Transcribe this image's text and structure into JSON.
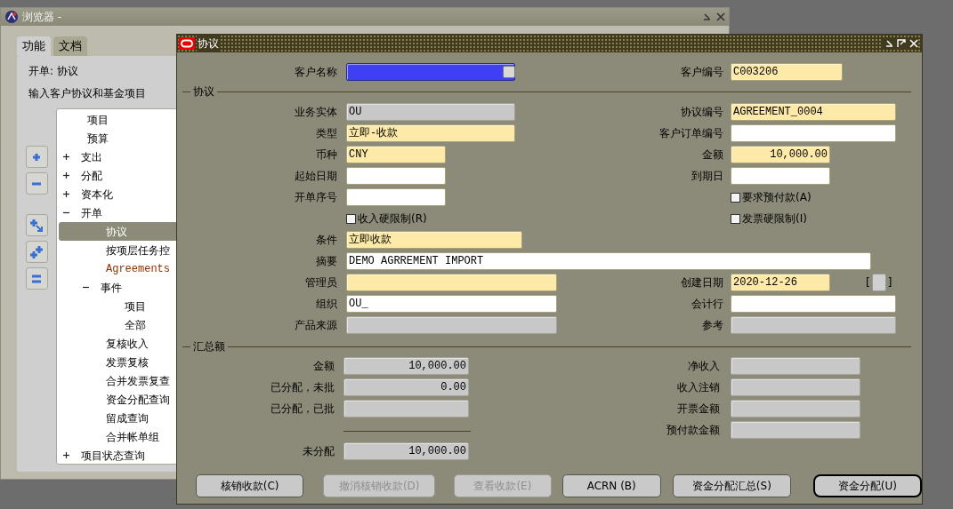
{
  "navigator": {
    "title": "浏览器 -",
    "tabs": [
      {
        "label": "功能",
        "selected": true
      },
      {
        "label": "文档",
        "selected": false
      }
    ],
    "path": "开单: 协议",
    "description": "输入客户协议和基金项目",
    "tree": [
      {
        "label": "项目",
        "kind": "node"
      },
      {
        "label": "预算",
        "kind": "node"
      },
      {
        "label": "支出",
        "kind": "node",
        "expanded": false
      },
      {
        "label": "分配",
        "kind": "node",
        "expanded": false
      },
      {
        "label": "资本化",
        "kind": "node",
        "expanded": false
      },
      {
        "label": "开单",
        "kind": "node",
        "expanded": true,
        "children": [
          {
            "label": "协议",
            "kind": "node",
            "selected": true
          },
          {
            "label": "按项层任务控",
            "kind": "node",
            "selected": false
          },
          {
            "label": "Agreements",
            "kind": "link",
            "selected": false
          },
          {
            "label": "事件",
            "kind": "node",
            "expanded": true,
            "children": [
              {
                "label": "项目",
                "kind": "node",
                "selected": false
              },
              {
                "label": "全部",
                "kind": "node",
                "selected": false
              }
            ]
          },
          {
            "label": "复核收入",
            "kind": "node",
            "selected": false
          },
          {
            "label": "发票复核",
            "kind": "node",
            "selected": false
          },
          {
            "label": "合并发票复查",
            "kind": "node",
            "selected": false
          },
          {
            "label": "资金分配查询",
            "kind": "node",
            "selected": false
          },
          {
            "label": "留成查询",
            "kind": "node",
            "selected": false
          },
          {
            "label": "合并帐单组",
            "kind": "node",
            "selected": false
          }
        ]
      },
      {
        "label": "项目状态查询",
        "kind": "node",
        "expanded": false
      }
    ]
  },
  "form": {
    "title": "协议",
    "header": [
      {
        "left": {
          "kind": "selected",
          "label": "客户名称"
        },
        "right": {
          "kind": "required",
          "label": "客户编号",
          "value": "C003206"
        }
      }
    ],
    "agreement_title": "协议",
    "rows": [
      {
        "left": {
          "kind": "readonly",
          "label": "业务实体",
          "value": "OU"
        },
        "right": {
          "kind": "required",
          "label": "协议编号",
          "value": "AGREEMENT_0004"
        }
      },
      {
        "left": {
          "kind": "required",
          "label": "类型",
          "value": "立即-收款"
        },
        "right": {
          "kind": "text",
          "label": "客户订单编号"
        }
      },
      {
        "left": {
          "kind": "required",
          "label": "币种",
          "value": "CNY"
        },
        "right": {
          "kind": "required",
          "label": "金额",
          "value": "10,000.00",
          "numeric": true
        }
      },
      {
        "left": {
          "kind": "text",
          "label": "起始日期"
        },
        "right": {
          "kind": "text",
          "label": "到期日"
        }
      },
      {
        "left": {
          "kind": "text",
          "label": "开单序号"
        },
        "right": {
          "kind": "checkbox",
          "label": "要求预付款(A)",
          "checked": false
        }
      },
      {
        "left": {
          "kind": "checkbox",
          "label": "收入硬限制(R)",
          "checked": false
        },
        "right": {
          "kind": "checkbox",
          "label": "发票硬限制(I)",
          "checked": false
        }
      },
      {
        "left": {
          "kind": "required",
          "label": "条件",
          "value": "立即收款"
        }
      },
      {
        "left": {
          "kind": "text",
          "label": "摘要",
          "value": "DEMO AGRREMENT IMPORT"
        }
      },
      {
        "left": {
          "kind": "required",
          "label": "管理员"
        },
        "right": {
          "kind": "required",
          "label": "创建日期",
          "value": "2020-12-26",
          "bracket_open": "[",
          "bracket_close": "]"
        }
      },
      {
        "left": {
          "kind": "text",
          "label": "组织",
          "value": "OU_"
        },
        "right": {
          "kind": "text",
          "label": "会计行"
        }
      },
      {
        "left": {
          "kind": "readonly",
          "label": "产品来源"
        },
        "right": {
          "kind": "readonly",
          "label": "参考"
        }
      }
    ],
    "totals_title": "汇总额",
    "totals": [
      {
        "left": {
          "kind": "readonly",
          "label": "金额",
          "value": "10,000.00",
          "numeric": true
        },
        "right": {
          "kind": "readonly",
          "label": "净收入"
        }
      },
      {
        "left": {
          "kind": "readonly",
          "label": "已分配，未批",
          "value": "0.00",
          "numeric": true
        },
        "right": {
          "kind": "readonly",
          "label": "收入注销"
        }
      },
      {
        "left": {
          "kind": "readonly",
          "label": "已分配，已批"
        },
        "right": {
          "kind": "readonly",
          "label": "开票金额"
        }
      },
      {
        "left": {
          "kind": "rule"
        },
        "right": {
          "kind": "readonly",
          "label": "预付款金额"
        }
      },
      {
        "left": {
          "kind": "readonly",
          "label": "未分配",
          "value": "10,000.00",
          "numeric": true
        }
      }
    ],
    "buttons": [
      {
        "label": "核销收款(C)",
        "disabled": false,
        "default": false
      },
      {
        "label": "撤消核销收款(D)",
        "disabled": true,
        "default": false
      },
      {
        "label": "查看收款(E)",
        "disabled": true,
        "default": false
      },
      {
        "label": "ACRN (B)",
        "disabled": false,
        "default": false
      },
      {
        "label": "资金分配汇总(S)",
        "disabled": false,
        "default": false
      },
      {
        "label": "资金分配(U)",
        "disabled": false,
        "default": true
      }
    ]
  }
}
